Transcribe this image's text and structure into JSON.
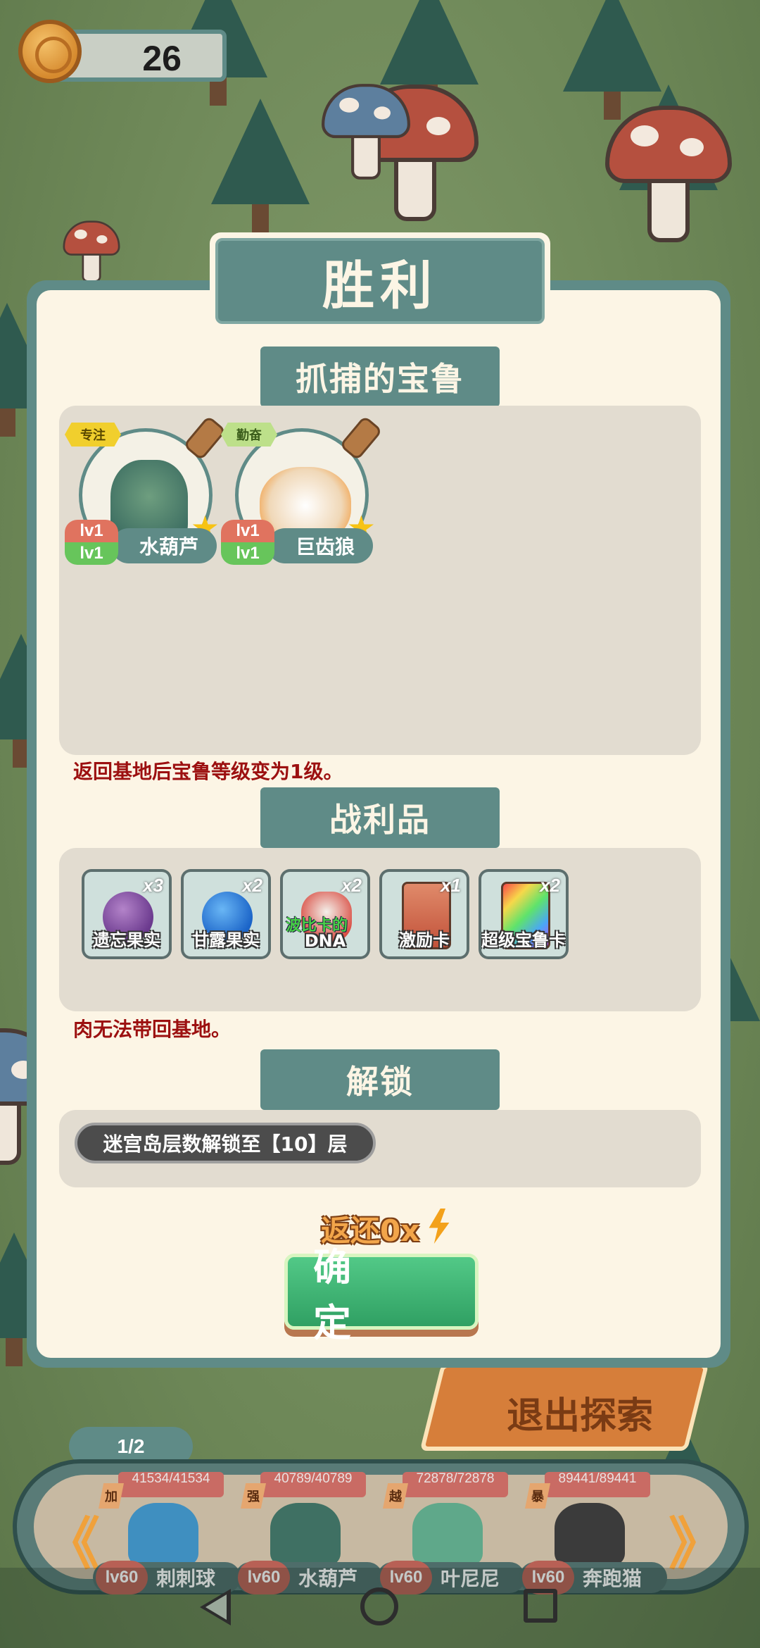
{
  "hud": {
    "coins": "26"
  },
  "dialog": {
    "title": "胜利",
    "captured_header": "抓捕的宝鲁",
    "captured_pets": [
      {
        "trait": "专注",
        "trait_color": "#f1cf2d",
        "level_top": "lv1",
        "level_bottom": "lv1",
        "name": "水葫芦"
      },
      {
        "trait": "勤奋",
        "trait_color": "#bde08a",
        "level_top": "lv1",
        "level_bottom": "lv1",
        "name": "巨齿狼"
      }
    ],
    "captured_note": "返回基地后宝鲁等级变为1级。",
    "loot_header": "战利品",
    "loot_items": [
      {
        "label": "遗忘果实",
        "qty": "x3"
      },
      {
        "label": "甘露果实",
        "qty": "x2"
      },
      {
        "label": "DNA",
        "overlay": "波比卡的",
        "qty": "x2"
      },
      {
        "label": "激励卡",
        "qty": "x1"
      },
      {
        "label": "超级宝鲁卡",
        "qty": "x2"
      }
    ],
    "loot_note": "肉无法带回基地。",
    "unlock_header": "解锁",
    "unlock_text": "迷宫岛层数解锁至【10】层",
    "refund_text": "返还0x",
    "confirm_label": "确 定"
  },
  "background": {
    "exit_button": "退出探索",
    "team_page": "1/2",
    "team": [
      {
        "tag": "加",
        "hp": "41534/41534",
        "level": "lv60",
        "name": "刺刺球"
      },
      {
        "tag": "强",
        "hp": "40789/40789",
        "level": "lv60",
        "name": "水葫芦"
      },
      {
        "tag": "越",
        "hp": "72878/72878",
        "level": "lv60",
        "name": "叶尼尼"
      },
      {
        "tag": "暴",
        "hp": "89441/89441",
        "level": "lv60",
        "name": "奔跑猫"
      }
    ],
    "arrow_left": "《",
    "arrow_right": "》"
  },
  "colors": {
    "panel_teal": "#5f8b87",
    "cream": "#fcf5e5",
    "note_red": "#9c1010",
    "confirm_green": "#30a063"
  }
}
